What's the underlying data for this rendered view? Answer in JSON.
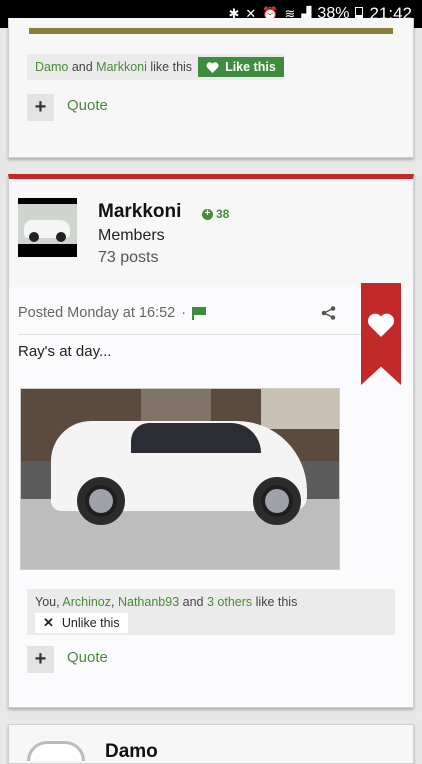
{
  "status_bar": {
    "battery": "38%",
    "time": "21:42",
    "icons": [
      "bluetooth-icon",
      "mute-icon",
      "alarm-icon",
      "wifi-icon",
      "signal-icon",
      "battery-icon"
    ]
  },
  "prev_post": {
    "likers": [
      "Damo",
      "Markkoni"
    ],
    "and_text": "and",
    "like_this_text": "like this",
    "like_button": "Like this",
    "quote": "Quote"
  },
  "post": {
    "username": "Markkoni",
    "reputation": "38",
    "group": "Members",
    "post_count": "73 posts",
    "posted": "Posted Monday at 16:52",
    "separator": "·",
    "content": "Ray's at day...",
    "likes": {
      "prefix": "You,",
      "user1": "Archinoz",
      "comma": ",",
      "user2": "Nathanb93",
      "and_text": "and",
      "others": "3 others",
      "suffix": "like this"
    },
    "unlike_button": "Unlike this",
    "quote": "Quote"
  },
  "next_post": {
    "username": "Damo"
  },
  "colors": {
    "accent_green": "#3e8c3e",
    "accent_red": "#c22a2a"
  }
}
